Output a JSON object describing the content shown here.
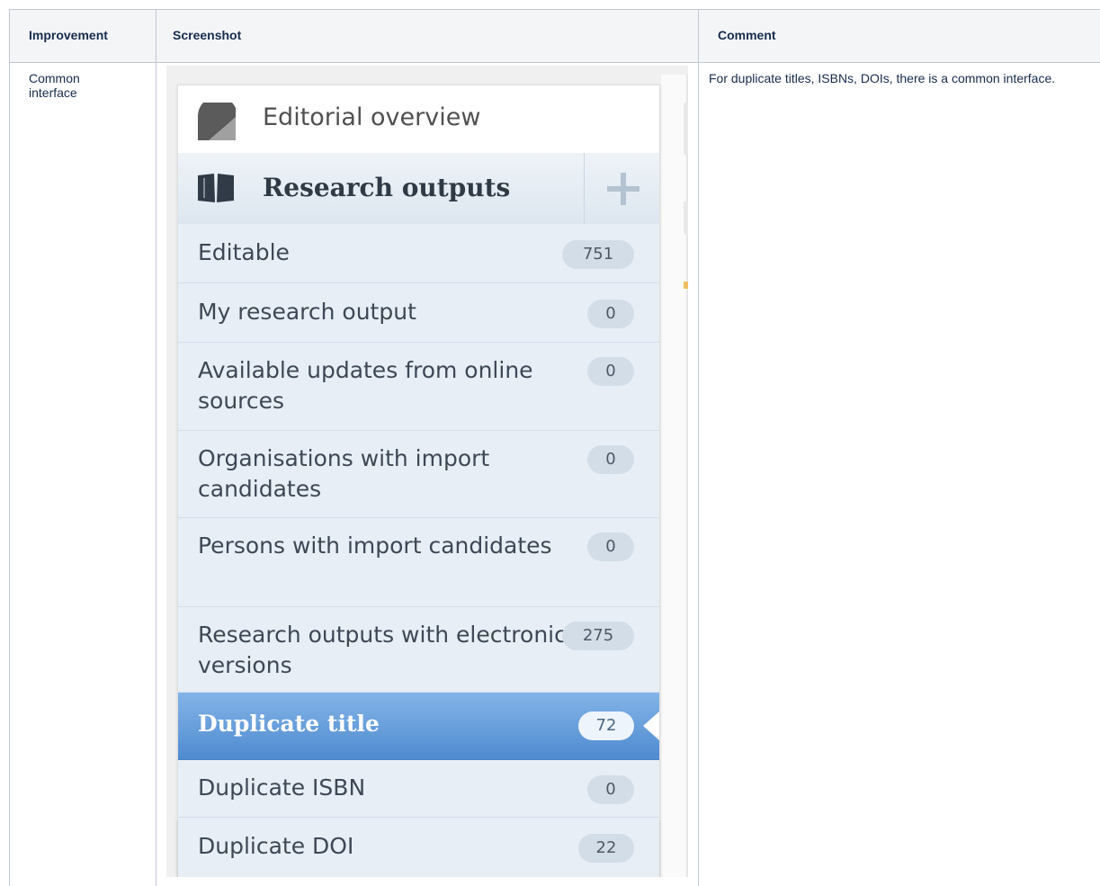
{
  "table": {
    "headers": {
      "improvement": "Improvement",
      "screenshot": "Screenshot",
      "comment": "Comment"
    },
    "row": {
      "improvement": "Common interface",
      "comment": "For duplicate titles, ISBNs, DOIs, there is a common interface."
    }
  },
  "sidebar": {
    "editorial_overview": "Editorial overview",
    "research_outputs": "Research outputs",
    "items": [
      {
        "label": "Editable",
        "count": "751"
      },
      {
        "label": "My research output",
        "count": "0"
      },
      {
        "label": "Available updates from online sources",
        "count": "0"
      },
      {
        "label": "Organisations with import candidates",
        "count": "0"
      },
      {
        "label": "Persons with import candidates",
        "count": "0"
      },
      {
        "label": "Research outputs with electronic versions",
        "count": "275"
      },
      {
        "label": "Duplicate title",
        "count": "72",
        "active": true
      },
      {
        "label": "Duplicate ISBN",
        "count": "0"
      },
      {
        "label": "Duplicate DOI",
        "count": "22"
      }
    ]
  },
  "colors": {
    "accent": "#5b97d8",
    "item_bg": "#e7eef6",
    "header_bg": "#f4f5f7"
  },
  "icons": {
    "editorial_overview": "pie-chart-icon",
    "research_outputs": "open-book-icon",
    "add": "plus-icon"
  }
}
